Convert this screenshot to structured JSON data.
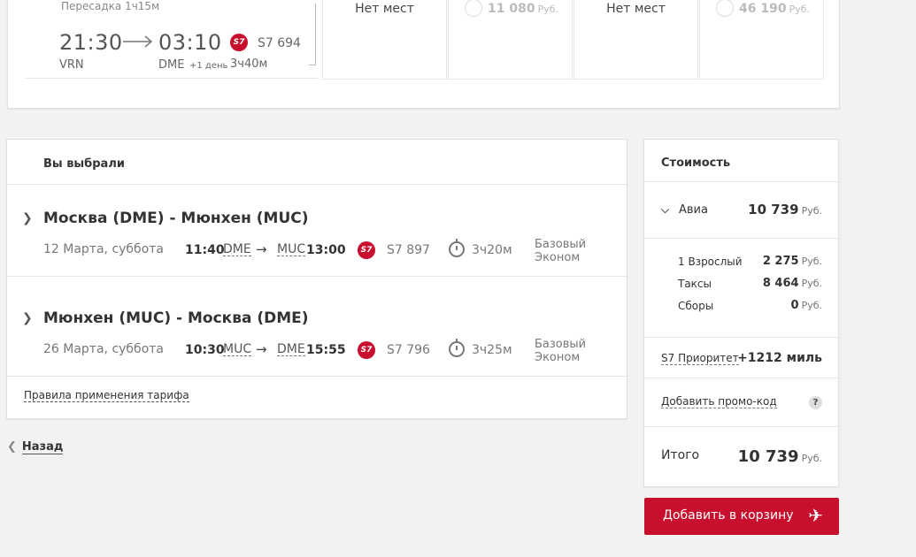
{
  "top_flight": {
    "transfer": "Пересадка 1ч15м",
    "dep_time": "21:30",
    "arr_time": "03:10",
    "dep_code": "VRN",
    "arr_code": "DME",
    "next_day": "+1 день",
    "duration": "3ч40м",
    "flight": "S7 694",
    "fares": [
      {
        "type": "na",
        "text": "Нет мест"
      },
      {
        "type": "price",
        "amount": "11 080",
        "currency": "Руб."
      },
      {
        "type": "na",
        "text": "Нет мест"
      },
      {
        "type": "price",
        "amount": "46 190",
        "currency": "Руб."
      }
    ]
  },
  "selected": {
    "header": "Вы выбрали",
    "legs": [
      {
        "route": "Москва (DME) - Мюнхен (MUC)",
        "date": "12 Марта, суббота",
        "dep_time": "11:40",
        "dep_code": "DME",
        "arrow": "→",
        "arr_code": "MUC",
        "arr_time": "13:00",
        "flight": "S7 897",
        "duration": "3ч20м",
        "fare_class": "Базовый Эконом"
      },
      {
        "route": "Мюнхен (MUC) - Москва (DME)",
        "date": "26 Марта, суббота",
        "dep_time": "10:30",
        "dep_code": "MUC",
        "arrow": "→",
        "arr_code": "DME",
        "arr_time": "15:55",
        "flight": "S7 796",
        "duration": "3ч25м",
        "fare_class": "Базовый Эконом"
      }
    ],
    "rules_link": "Правила применения тарифа"
  },
  "back_label": "Назад",
  "price": {
    "title": "Стоимость",
    "avia_label": "Авиа",
    "avia_amount": "10 739",
    "currency": "Руб.",
    "breakdown": [
      {
        "label": "1 Взрослый",
        "amount": "2 275"
      },
      {
        "label": "Таксы",
        "amount": "8 464"
      },
      {
        "label": "Сборы",
        "amount": "0"
      }
    ],
    "priority_label": "S7 Приоритет",
    "priority_value": "+1212 миль",
    "promo_label": "Добавить промо-код",
    "help_label": "?",
    "total_label": "Итого",
    "total_amount": "10 739"
  },
  "add_to_cart": "Добавить в корзину",
  "brand_color": "#c8102e"
}
